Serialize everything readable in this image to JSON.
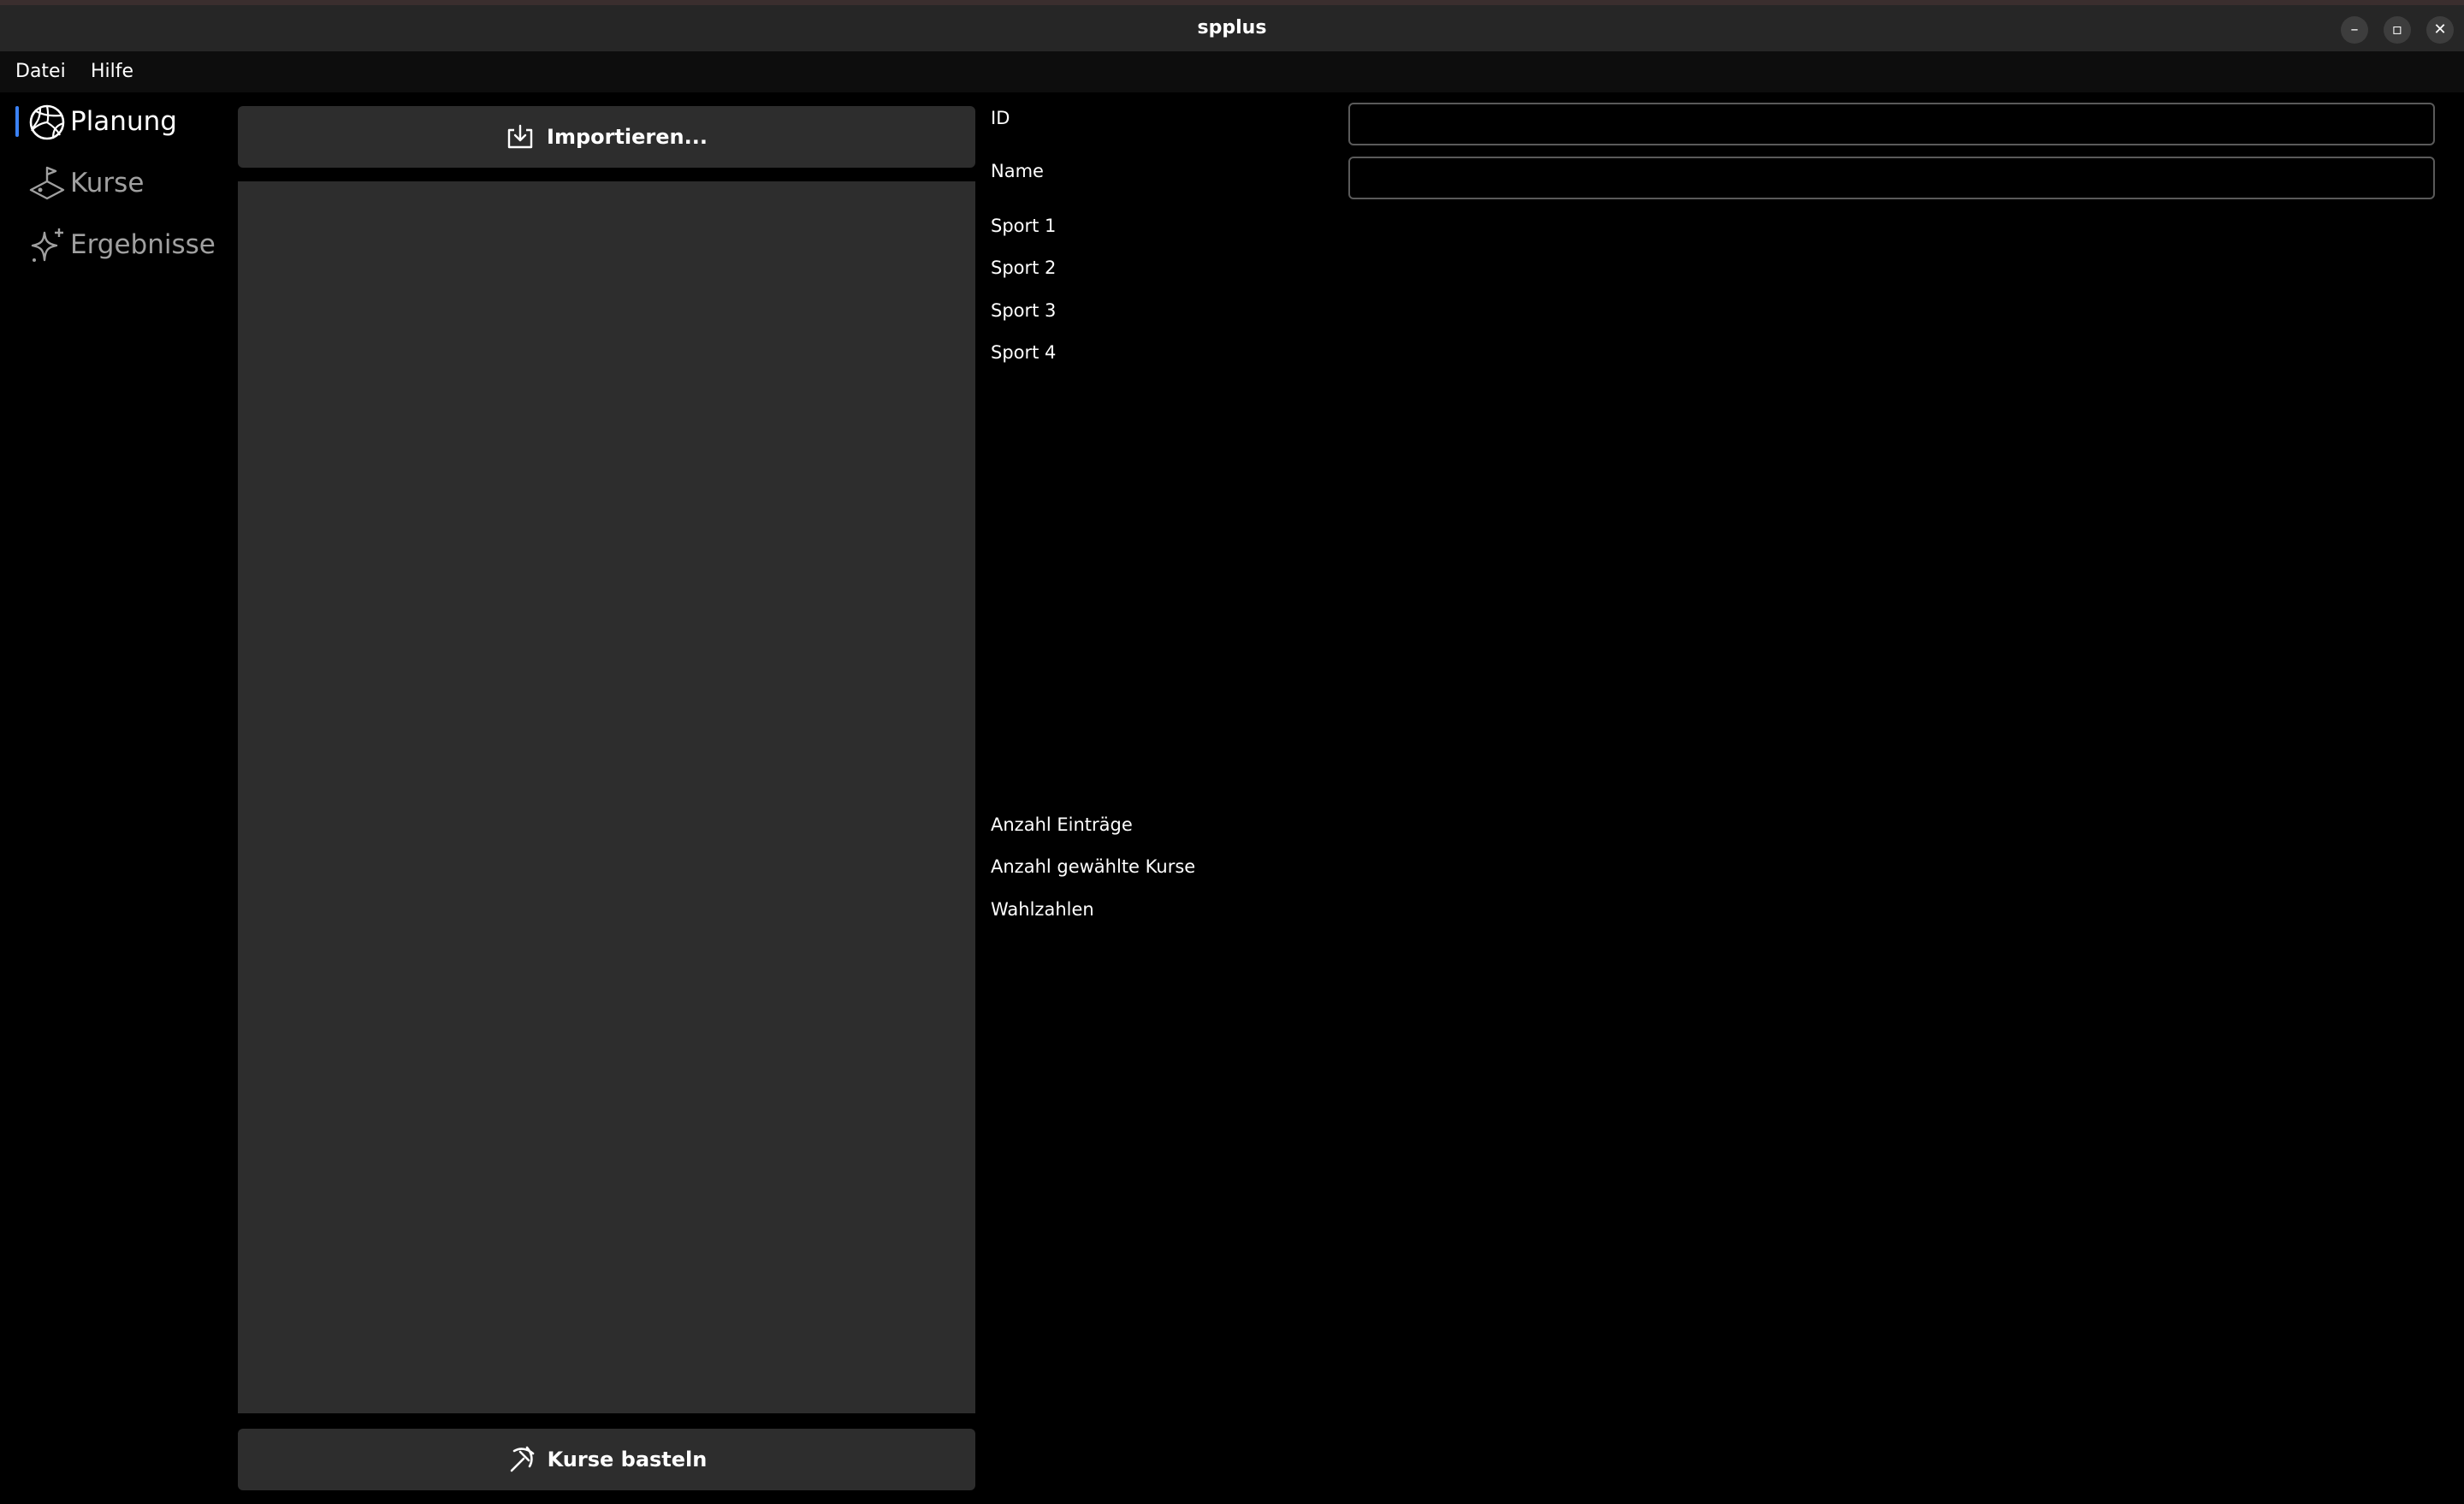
{
  "window": {
    "title": "spplus",
    "minimize": "–",
    "maximize": "▫",
    "close": "✕"
  },
  "menu": {
    "items": [
      "Datei",
      "Hilfe"
    ]
  },
  "sidebar": {
    "items": [
      {
        "label": "Planung",
        "icon": "volleyball-icon",
        "active": true
      },
      {
        "label": "Kurse",
        "icon": "course-icon",
        "active": false
      },
      {
        "label": "Ergebnisse",
        "icon": "sparkle-icon",
        "active": false
      }
    ]
  },
  "buttons": {
    "import": "Importieren...",
    "build": "Kurse basteln"
  },
  "form": {
    "id": {
      "label": "ID",
      "value": ""
    },
    "name": {
      "label": "Name",
      "value": ""
    },
    "sports": [
      "Sport 1",
      "Sport 2",
      "Sport 3",
      "Sport 4"
    ],
    "stats": [
      "Anzahl Einträge",
      "Anzahl gewählte Kurse",
      "Wahlzahlen"
    ]
  },
  "colors": {
    "background": "#000000",
    "panel": "#2d2d2d",
    "accent": "#3b82f6",
    "text": "#ffffff",
    "muted_text": "#a0a0a0"
  }
}
